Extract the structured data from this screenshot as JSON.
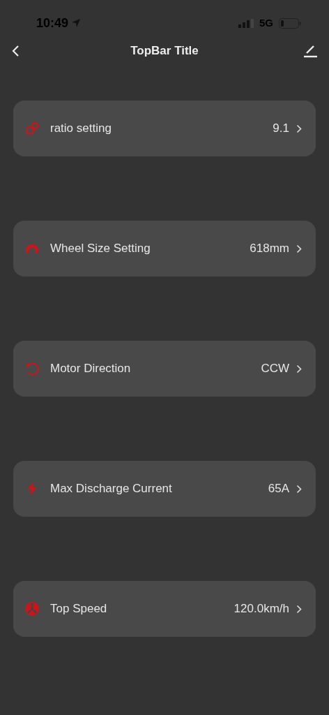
{
  "status_bar": {
    "time": "10:49",
    "network": "5G"
  },
  "top_bar": {
    "title": "TopBar Title"
  },
  "settings": [
    {
      "kind": "gears",
      "label": "ratio setting",
      "value": "9.1"
    },
    {
      "kind": "wheel",
      "label": "Wheel Size Setting",
      "value": "618mm"
    },
    {
      "kind": "rotate",
      "label": "Motor Direction",
      "value": "CCW"
    },
    {
      "kind": "bolt",
      "label": "Max Discharge Current",
      "value": "65A"
    },
    {
      "kind": "fan",
      "label": "Top Speed",
      "value": "120.0km/h"
    }
  ]
}
